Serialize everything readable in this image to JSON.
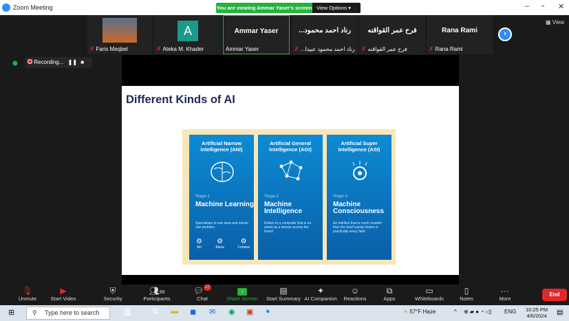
{
  "window": {
    "title": "Zoom Meeting",
    "viewing_banner": "You are viewing Ammar Yaser's screen",
    "view_options": "View Options",
    "view_link": "View"
  },
  "participants": [
    {
      "tile_name": "",
      "label": "Faris Meqbel",
      "muted": true
    },
    {
      "tile_name": "A",
      "label": "Ateka M. Khader",
      "muted": true
    },
    {
      "tile_name": "Ammar Yaser",
      "label": "Ammar Yaser",
      "muted": false
    },
    {
      "tile_name": "...رناد احمد محمود",
      "label": "...رناد احمد محمود عبيدا",
      "muted": true
    },
    {
      "tile_name": "فرح عمر القواقنه",
      "label": "فرح عمر القواقنه",
      "muted": true
    },
    {
      "tile_name": "Rana Rami",
      "label": "Rana Rami",
      "muted": true
    }
  ],
  "recording": {
    "label": "Recording..."
  },
  "slide": {
    "title": "Different Kinds of AI",
    "panels": [
      {
        "heading": "Artificial Narrow Intelligence (ANI)",
        "stage": "Stage-1",
        "name": "Machine Learning",
        "desc": "Specialises in one area and solves one problem",
        "icon_labels": [
          "Siri",
          "Alexa",
          "Cortana"
        ]
      },
      {
        "heading": "Artificial General Intelligence (AGI)",
        "stage": "Stage-2",
        "name": "Machine Intelligence",
        "desc": "Refers to a computer that is as smart as a human across the board"
      },
      {
        "heading": "Artificial Super Intelligence (ASI)",
        "stage": "Stage-3",
        "name": "Machine Consciousness",
        "desc": "An intellect that is much smarter than the best human brains in practically every field"
      }
    ]
  },
  "toolbar": {
    "unmute": "Unmute",
    "start_video": "Start Video",
    "security": "Security",
    "participants": "Participants",
    "participants_count": "88",
    "chat": "Chat",
    "chat_badge": "27",
    "share_screen": "Share Screen",
    "start_summary": "Start Summary",
    "ai_companion": "AI Companion",
    "reactions": "Reactions",
    "apps": "Apps",
    "whiteboards": "Whiteboards",
    "notes": "Notes",
    "more": "More",
    "end": "End"
  },
  "taskbar": {
    "search_placeholder": "Type here to search",
    "weather": "57°F  Haze",
    "lang": "ENG",
    "time": "10:25 PM",
    "date": "4/6/2024"
  },
  "colors": {
    "zoom_blue": "#2d8cff",
    "viewing_green": "#25b13e",
    "end_red": "#e02828",
    "slide_title": "#1f2654",
    "panel_blue": "#0a6fb8"
  }
}
